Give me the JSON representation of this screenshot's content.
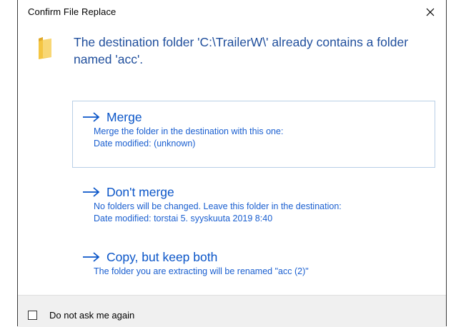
{
  "window": {
    "title": "Confirm File Replace",
    "close_icon": "close-icon"
  },
  "message": {
    "icon": "folder-icon",
    "text": "The destination folder 'C:\\TrailerW\\' already contains a folder named 'acc'."
  },
  "options": [
    {
      "title": "Merge",
      "line1": "Merge the folder in the destination with this one:",
      "line2": "Date modified: (unknown)"
    },
    {
      "title": "Don't merge",
      "line1": "No folders will be changed. Leave this folder in the destination:",
      "line2": "Date modified: torstai 5. syyskuuta 2019  8:40"
    },
    {
      "title": "Copy, but keep both",
      "line1": "The folder you are extracting will be renamed \"acc (2)\""
    }
  ],
  "footer": {
    "checkbox_label": "Do not ask me again",
    "checked": false
  },
  "colors": {
    "accent": "#0a55c8",
    "message": "#1f4e9c",
    "selected_border": "#b8cfe6",
    "footer_bg": "#f0f0f0"
  }
}
